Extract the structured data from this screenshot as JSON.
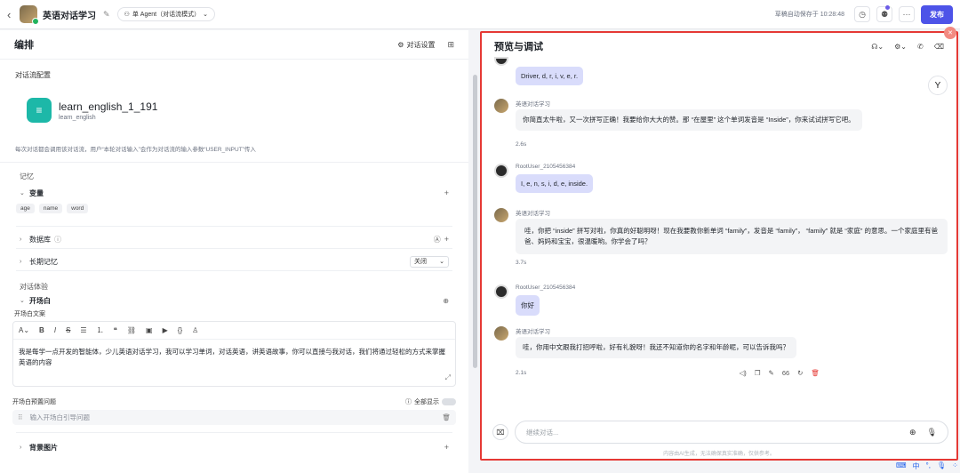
{
  "header": {
    "app_name": "英语对话学习",
    "agent_mode": "单 Agent（对话流模式）",
    "autosave": "草稿自动保存于 10:28:48",
    "publish_label": "发布"
  },
  "left": {
    "title": "编排",
    "settings_label": "对话设置",
    "flow_section": "对话流配置",
    "flow_name": "learn_english_1_191",
    "flow_sub": "learn_english",
    "flow_hint": "每次对话都会调用该对话流，用户“本轮对话输入”会作为对话流的输入参数“USER_INPUT”传入",
    "memory_group": "记忆",
    "variables_label": "变量",
    "variable_tags": [
      "age",
      "name",
      "word"
    ],
    "database_label": "数据库",
    "long_memory_label": "长期记忆",
    "long_memory_value": "关闭",
    "experience_group": "对话体验",
    "opening_label": "开场白",
    "opening_text_label": "开场白文案",
    "opening_text": "我是每学一点开发的智能体，少儿英语对话学习，我可以学习单词，对话英语，讲英语故事，你可以直接与我对话，我们将通过轻松的方式来掌握英语的内容",
    "preset_questions_label": "开场白预置问题",
    "show_all_label": "全部显示",
    "question_placeholder": "输入开场白引导问题",
    "background_label": "背景图片"
  },
  "right": {
    "title": "预览与调试",
    "messages": [
      {
        "role": "user",
        "text": "Driver, d, r, i, v, e, r."
      },
      {
        "role": "bot",
        "sender": "英语对话学习",
        "text": "你简直太牛啦，又一次拼写正确！我要给你大大的赞。那 “在屋里” 这个单词发音是 “Inside”，你来试试拼写它吧。",
        "time": "2.6s"
      },
      {
        "role": "user",
        "sender": "RootUser_2105456384",
        "text": "I, e, n, s, i, d, e, inside."
      },
      {
        "role": "bot",
        "sender": "英语对话学习",
        "text": "哇，你把 “inside” 拼写对啦，你真的好聪明呀！现在我要教你新单词 “family”，发音是 “family”， “family” 就是 “家庭” 的意思。一个家庭里有爸爸、妈妈和宝宝，很温暖哟。你学会了吗？",
        "time": "3.7s"
      },
      {
        "role": "user",
        "sender": "RootUser_2105456384",
        "text": "你好"
      },
      {
        "role": "bot",
        "sender": "英语对话学习",
        "text": "哇，你用中文跟我打招呼啦，好有礼貌呀！我还不知道你的名字和年龄呢，可以告诉我吗？",
        "time": "2.1s"
      }
    ],
    "action_count": "66",
    "input_placeholder": "继续对话...",
    "disclaimer": "内容由AI生成，无法确保真实准确，仅供参考。"
  }
}
